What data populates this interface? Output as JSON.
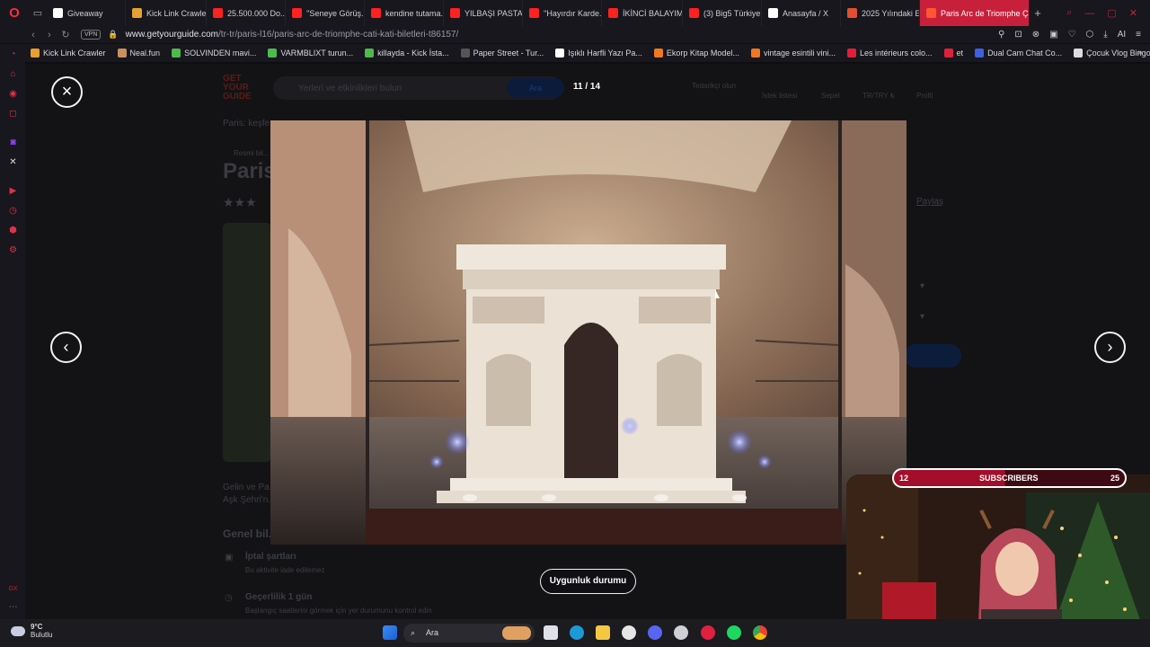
{
  "browser": {
    "tabs": [
      {
        "label": "Giveaway",
        "color": "#ffffff"
      },
      {
        "label": "Kick Link Crawler",
        "color": "#e8a030"
      },
      {
        "label": "25.500.000 Do...",
        "color": "#ff2020"
      },
      {
        "label": "''Seneye Görüş...",
        "color": "#ff2020"
      },
      {
        "label": "kendine tutama...",
        "color": "#ff2020"
      },
      {
        "label": "YILBAŞI PASTA...",
        "color": "#ff2020"
      },
      {
        "label": "''Hayırdır Karde...",
        "color": "#ff2020"
      },
      {
        "label": "İKİNCİ BALAYIM...",
        "color": "#ff2020"
      },
      {
        "label": "(3) Big5 Türkiye",
        "color": "#ff2020"
      },
      {
        "label": "Anasayfa / X",
        "color": "#ffffff"
      },
      {
        "label": "2025 Yılındaki E...",
        "color": "#e05030"
      },
      {
        "label": "Paris Arc de Triomphe Çat...",
        "color": "#ff5533",
        "active": true
      }
    ],
    "new_tab": "+",
    "vpn_label": "VPN",
    "url_host": "www.getyourguide.com",
    "url_path": "/tr-tr/paris-l16/paris-arc-de-triomphe-cati-kati-biletleri-t86157/",
    "ai_label": "AI",
    "bookmarks": [
      {
        "label": "Kick Link Crawler",
        "color": "#e8a030"
      },
      {
        "label": "Neal.fun",
        "color": "#c9925a"
      },
      {
        "label": "SOLVINDEN mavi...",
        "color": "#4fb84f"
      },
      {
        "label": "VARMBLIXT turun...",
        "color": "#4fb84f"
      },
      {
        "label": "killayda - Kick İsta...",
        "color": "#4fb84f"
      },
      {
        "label": "Paper Street - Tur...",
        "color": "#555555"
      },
      {
        "label": "Işıklı Harfli Yazı Pa...",
        "color": "#ffffff"
      },
      {
        "label": "Ekorp Kitap Model...",
        "color": "#f07820"
      },
      {
        "label": "vintage esintili vini...",
        "color": "#f07820"
      },
      {
        "label": "Les intérieurs colo...",
        "color": "#e0203a"
      },
      {
        "label": "et",
        "color": "#e0203a"
      },
      {
        "label": "Dual Cam Chat Co...",
        "color": "#4060e0"
      },
      {
        "label": "Çocuk Vlog Bingosu",
        "color": "#dddddd"
      }
    ]
  },
  "page": {
    "logo_line1": "GET",
    "logo_line2": "YOUR",
    "logo_line3": "GUIDE",
    "search_placeholder": "Yerleri ve etkinlikleri bulun",
    "search_button": "Ara",
    "nav_supplier": "Tedarikçi olun",
    "nav_wishlist": "İstek listesi",
    "nav_cart": "Sepet",
    "nav_lang": "TR/TRY ₺",
    "nav_profile": "Profil",
    "breadcrumb": "Paris: keşfe...",
    "badge": "Resmi bil...",
    "title": "Paris",
    "share": "Paylaş",
    "desc_line1": "Gelin ve Pa...",
    "desc_line2": "Aşk Şehri'n...",
    "section_title": "Genel bil...",
    "cancel_title": "İptal şartları",
    "cancel_sub": "Bu aktivite iade edilemez",
    "valid_title": "Geçerlilik 1 gün",
    "valid_sub": "Başlangıç saatlerini görmek için yer durumunu kontrol edin"
  },
  "gallery": {
    "close_icon": "×",
    "counter": "11 / 14",
    "prev_icon": "‹",
    "next_icon": "›",
    "availability_button": "Uygunluk durumu"
  },
  "taskbar": {
    "temperature": "9°C",
    "weather_desc": "Bulutlu",
    "search_label": "Ara"
  },
  "stream_overlay": {
    "sub_current": "12",
    "sub_label": "SUBSCRIBERS",
    "sub_goal": "25",
    "sub_progress": 0.48
  }
}
